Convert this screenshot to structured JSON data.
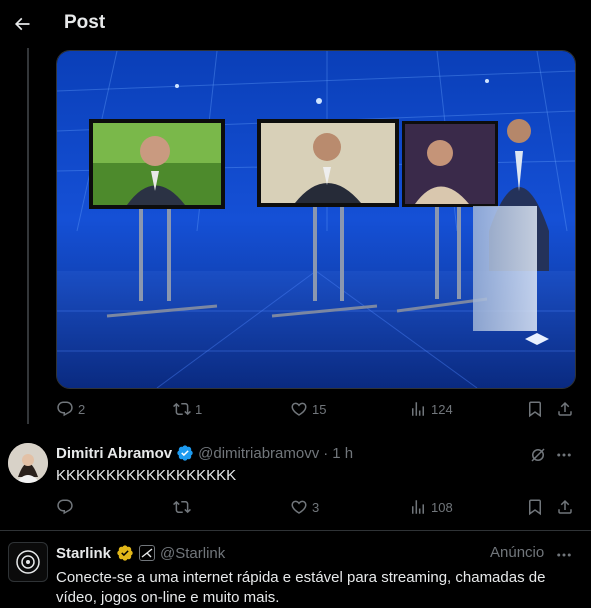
{
  "header": {
    "title": "Post"
  },
  "icons": {
    "back": "arrow-left-icon",
    "reply": "reply-icon",
    "repost": "repost-icon",
    "like": "heart-icon",
    "views": "views-icon",
    "bookmark": "bookmark-icon",
    "share": "share-icon",
    "verified": "verified-badge-icon",
    "grok": "grok-icon",
    "more": "more-icon"
  },
  "main_post": {
    "stats": {
      "replies": "2",
      "reposts": "1",
      "likes": "15",
      "views": "124"
    }
  },
  "reply": {
    "name": "Dimitri Abramov",
    "handle": "@dimitriabramovv",
    "separator": "·",
    "time": "1 h",
    "text": "KKKKKKKKKKKKKKKKKK",
    "stats": {
      "replies": "",
      "reposts": "",
      "likes": "3",
      "views": "108"
    }
  },
  "ad": {
    "name": "Starlink",
    "handle": "@Starlink",
    "label": "Anúncio",
    "text": "Conecte-se a uma internet rápida e estável para streaming, chamadas de vídeo, jogos on-line e muito mais."
  },
  "colors": {
    "background": "#000000",
    "text": "#e7e9ea",
    "muted": "#71767b",
    "verified_gold": "#e2b719",
    "verified_blue": "#1d9bf0"
  }
}
